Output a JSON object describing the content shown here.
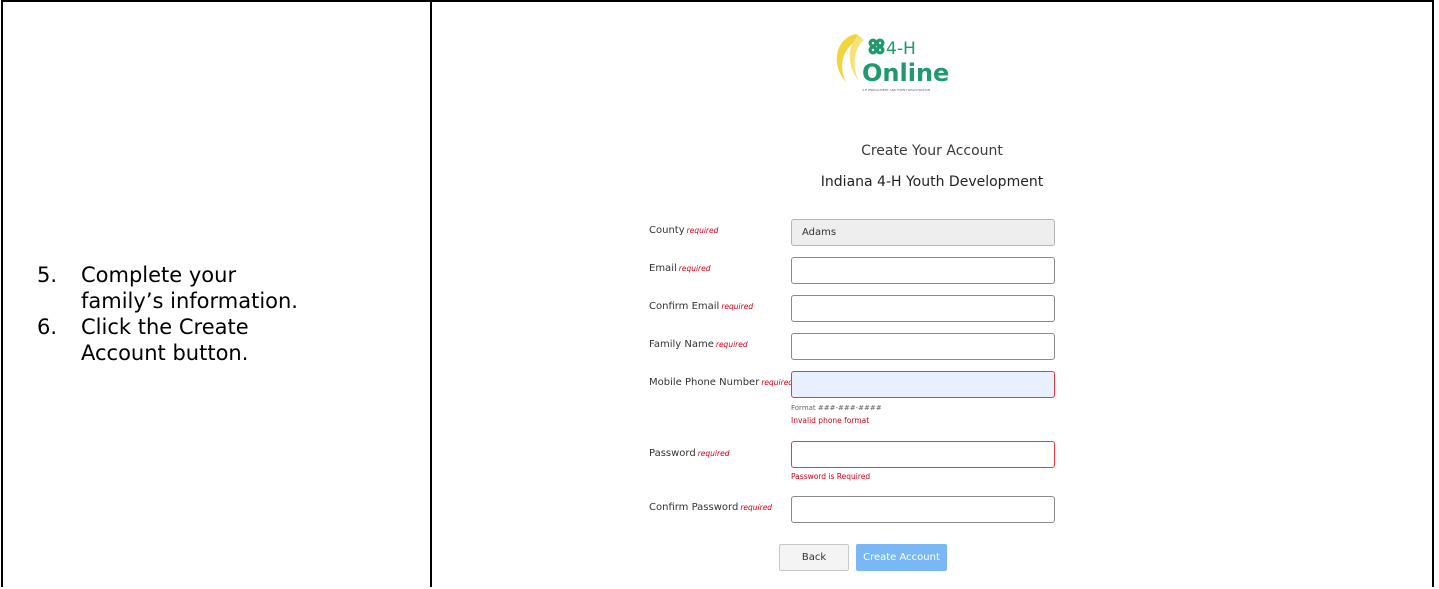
{
  "instructions": [
    {
      "number": "5.",
      "lines": [
        "Complete your",
        "family’s information."
      ]
    },
    {
      "number": "6.",
      "lines": [
        "Click the Create",
        "Account button."
      ]
    }
  ],
  "logo": {
    "line1": "4-H",
    "line2": "Online",
    "tagline": "4-H ENROLLMENT AND EVENT REGISTRATION"
  },
  "form": {
    "title": "Create Your Account",
    "subtitle": "Indiana 4-H Youth Development",
    "required_marker": "required",
    "fields": [
      {
        "label": "County",
        "value": "Adams"
      },
      {
        "label": "Email",
        "value": ""
      },
      {
        "label": "Confirm Email",
        "value": ""
      },
      {
        "label": "Family Name",
        "value": ""
      },
      {
        "label": "Mobile Phone Number",
        "value": ""
      },
      {
        "label": "Password",
        "value": ""
      },
      {
        "label": "Confirm Password",
        "value": ""
      }
    ],
    "phone_hint": "Format ###-###-####",
    "phone_error": "Invalid phone format",
    "password_error": "Password is Required",
    "back_label": "Back",
    "create_label": "Create Account"
  },
  "colors": {
    "accent_blue": "#7ab8f5",
    "error_red": "#d0021b",
    "logo_green": "#1f9a6b",
    "logo_yellow": "#f2d43c"
  }
}
